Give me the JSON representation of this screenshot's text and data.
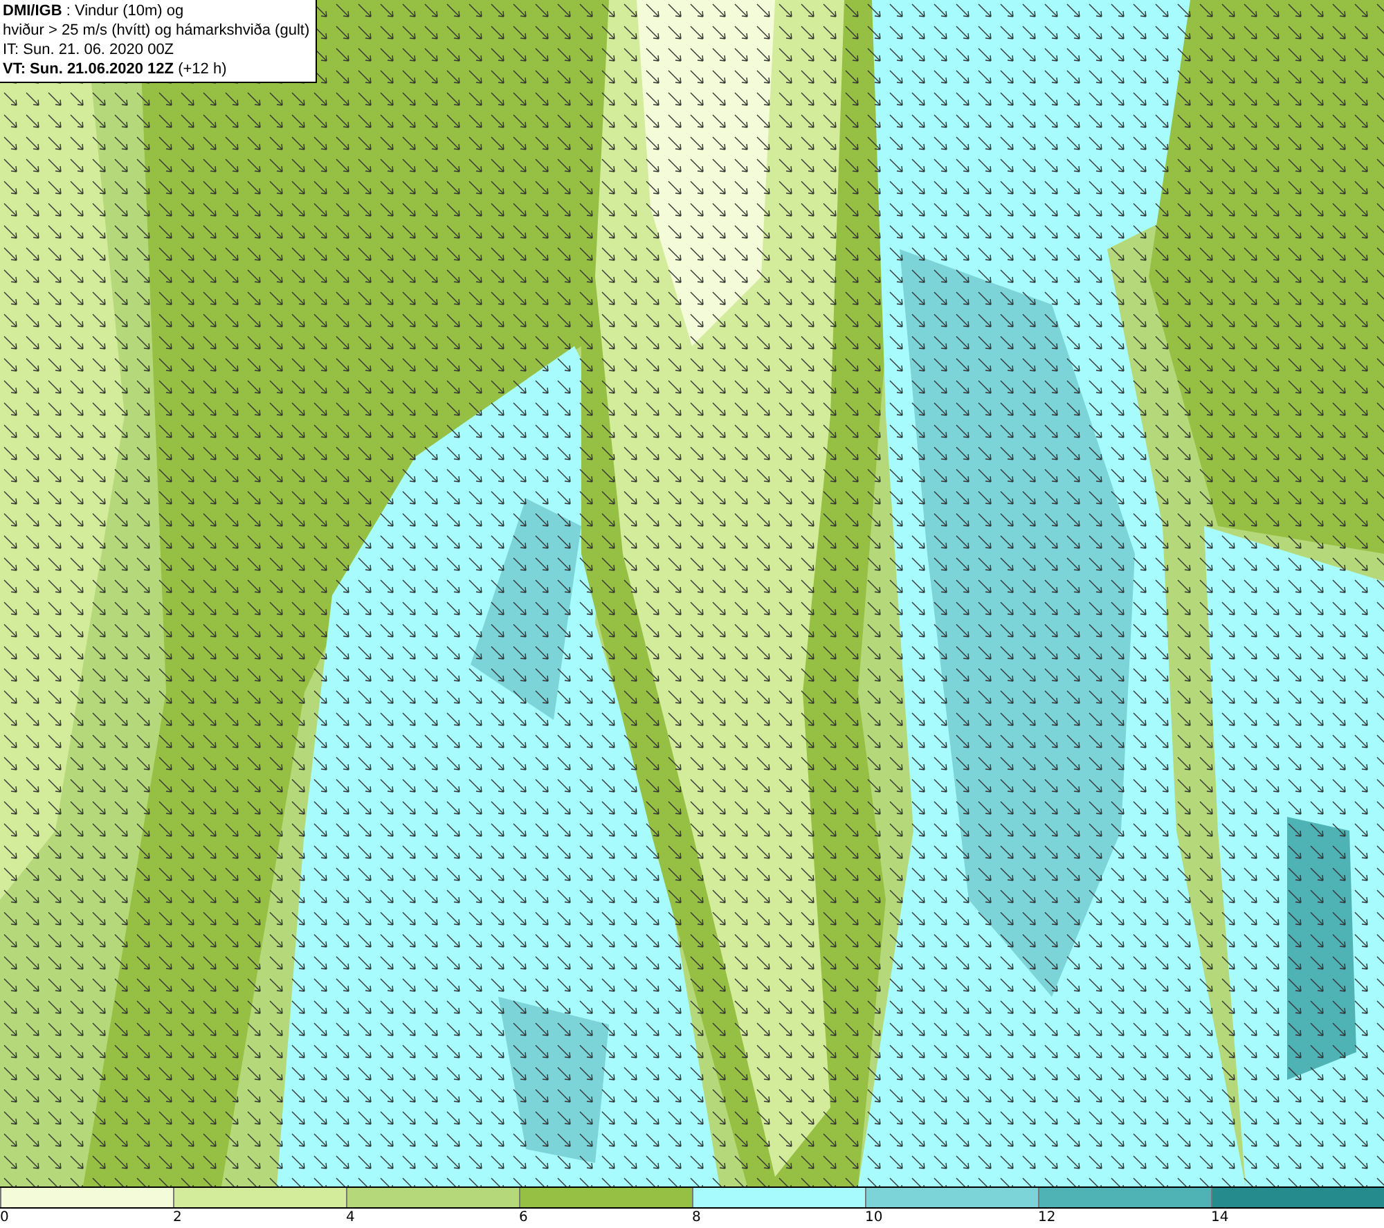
{
  "header": {
    "lines": [
      "**DMI/IGB** : Vindur (10m) og",
      "hviður > 25 m/s (hvítt) og hámarkshviða (gult)",
      "IT: Sun. 21. 06. 2020 00Z",
      "**VT: Sun. 21.06.2020 12Z** (+12 h)"
    ]
  },
  "legend": [
    {
      "label": "0",
      "color": "#f4fbd9"
    },
    {
      "label": "2",
      "color": "#d3ec9c"
    },
    {
      "label": "4",
      "color": "#b5d97a"
    },
    {
      "label": "6",
      "color": "#96c043"
    },
    {
      "label": "8",
      "color": "#a8fbfc"
    },
    {
      "label": "10",
      "color": "#7dd4d8"
    },
    {
      "label": "12",
      "color": "#4fb3b5"
    },
    {
      "label": "14",
      "color": "#268b8c"
    }
  ]
}
